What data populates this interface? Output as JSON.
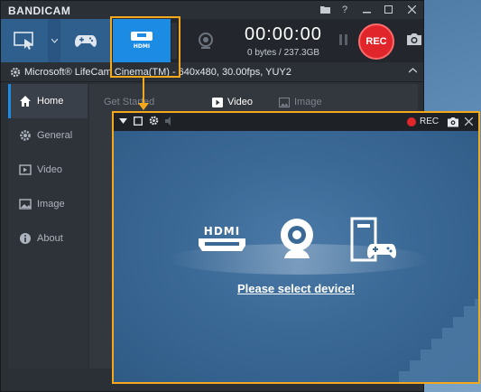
{
  "app": {
    "title": "BANDICAM"
  },
  "toolbar": {
    "timer": "00:00:00",
    "size_info": "0 bytes / 237.3GB",
    "rec_label": "REC"
  },
  "device": {
    "name": "Microsoft® LifeCam Cinema(TM) - 640x480, 30.00fps, YUY2"
  },
  "sidebar": {
    "items": [
      {
        "label": "Home",
        "icon": "home-icon"
      },
      {
        "label": "General",
        "icon": "gear-icon"
      },
      {
        "label": "Video",
        "icon": "video-icon"
      },
      {
        "label": "Image",
        "icon": "image-icon"
      },
      {
        "label": "About",
        "icon": "info-icon"
      }
    ]
  },
  "tabs": [
    {
      "label": "Get Started"
    },
    {
      "label": "Video"
    },
    {
      "label": "Image"
    }
  ],
  "preview": {
    "rec_label": "REC",
    "message": "Please select device!"
  },
  "colors": {
    "accent": "#1c8be4",
    "highlight": "#f4a81c",
    "rec": "#e0262b"
  }
}
